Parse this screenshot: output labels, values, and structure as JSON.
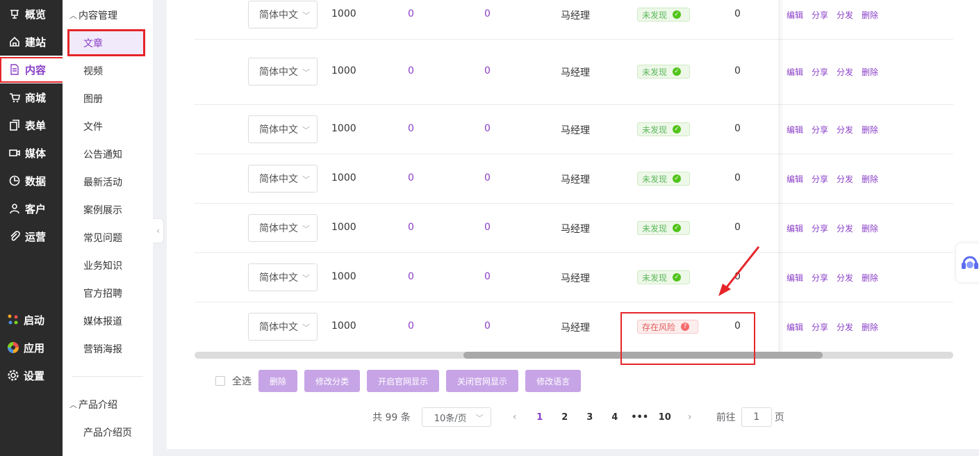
{
  "nav": {
    "items": [
      {
        "label": "概览",
        "icon": "overview-icon"
      },
      {
        "label": "建站",
        "icon": "home-icon"
      },
      {
        "label": "内容",
        "icon": "document-icon"
      },
      {
        "label": "商城",
        "icon": "cart-icon"
      },
      {
        "label": "表单",
        "icon": "form-icon"
      },
      {
        "label": "媒体",
        "icon": "video-icon"
      },
      {
        "label": "数据",
        "icon": "chart-icon"
      },
      {
        "label": "客户",
        "icon": "user-icon"
      },
      {
        "label": "运营",
        "icon": "clip-icon"
      }
    ],
    "bottom": [
      {
        "label": "启动",
        "icon": "launch-icon"
      },
      {
        "label": "应用",
        "icon": "apps-icon"
      },
      {
        "label": "设置",
        "icon": "gear-icon"
      }
    ],
    "active": "内容"
  },
  "sub": {
    "group1": "内容管理",
    "items": [
      "文章",
      "视频",
      "图册",
      "文件",
      "公告通知",
      "最新活动",
      "案例展示",
      "常见问题",
      "业务知识",
      "官方招聘",
      "媒体报道",
      "营销海报"
    ],
    "group2": "产品介绍",
    "items2": [
      "产品介绍页"
    ],
    "active": "文章"
  },
  "table": {
    "rows": [
      {
        "lang": "简体中文",
        "c1": "1000",
        "c2": "0",
        "c3": "0",
        "author": "马经理",
        "status": "未发现",
        "status_type": "ok",
        "count": "0"
      },
      {
        "lang": "简体中文",
        "c1": "1000",
        "c2": "0",
        "c3": "0",
        "author": "马经理",
        "status": "未发现",
        "status_type": "ok",
        "count": "0"
      },
      {
        "lang": "简体中文",
        "c1": "1000",
        "c2": "0",
        "c3": "0",
        "author": "马经理",
        "status": "未发现",
        "status_type": "ok",
        "count": "0"
      },
      {
        "lang": "简体中文",
        "c1": "1000",
        "c2": "0",
        "c3": "0",
        "author": "马经理",
        "status": "未发现",
        "status_type": "ok",
        "count": "0"
      },
      {
        "lang": "简体中文",
        "c1": "1000",
        "c2": "0",
        "c3": "0",
        "author": "马经理",
        "status": "未发现",
        "status_type": "ok",
        "count": "0"
      },
      {
        "lang": "简体中文",
        "c1": "1000",
        "c2": "0",
        "c3": "0",
        "author": "马经理",
        "status": "未发现",
        "status_type": "ok",
        "count": "0"
      },
      {
        "lang": "简体中文",
        "c1": "1000",
        "c2": "0",
        "c3": "0",
        "author": "马经理",
        "status": "存在风险",
        "status_type": "risk",
        "count": "0"
      }
    ],
    "ops": [
      "编辑",
      "分享",
      "分发",
      "删除"
    ]
  },
  "toolbar": {
    "select_all": "全选",
    "buttons": [
      "删除",
      "修改分类",
      "开启官网显示",
      "关闭官网显示",
      "修改语言"
    ]
  },
  "pager": {
    "total": "共 99 条",
    "size": "10条/页",
    "pages": [
      "1",
      "2",
      "3",
      "4",
      "•••",
      "10"
    ],
    "current": "1",
    "goto_label": "前往",
    "goto_value": "1",
    "page_unit": "页"
  },
  "colors": {
    "accent": "#8a3fc7",
    "nav_bg": "#2b2b2b",
    "highlight": "#e5252a"
  }
}
